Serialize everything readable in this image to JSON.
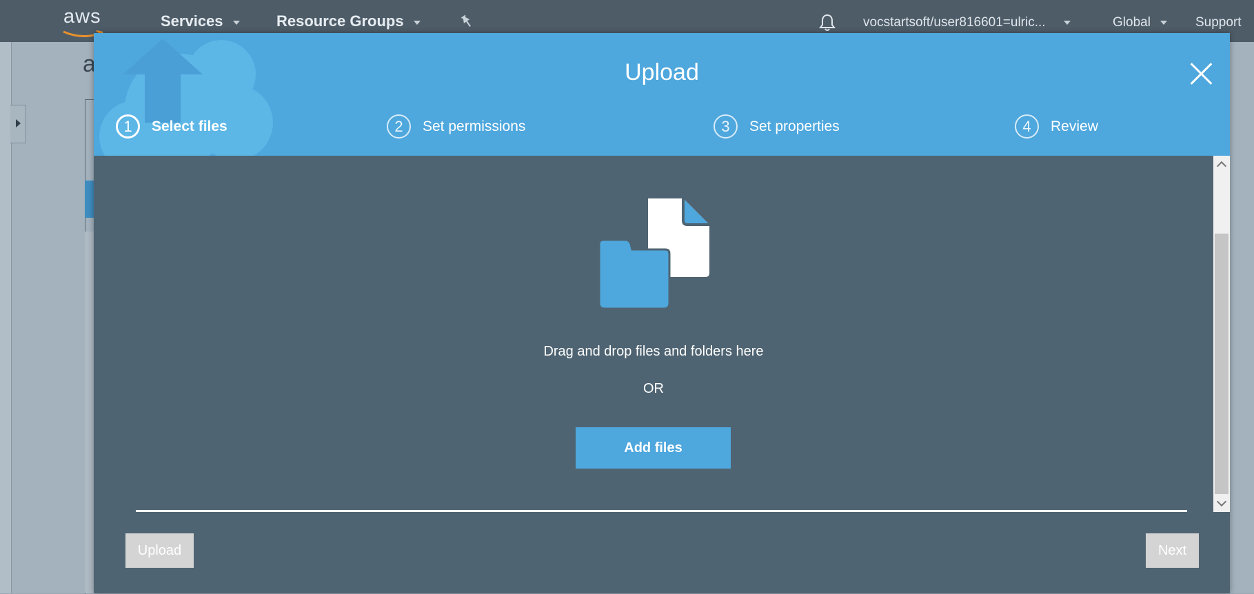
{
  "topnav": {
    "logo": "aws",
    "services": "Services",
    "resource_groups": "Resource Groups",
    "account": "vocstartsoft/user816601=ulric...",
    "region": "Global",
    "support": "Support"
  },
  "background": {
    "title_fragment": "a"
  },
  "modal": {
    "title": "Upload",
    "steps": [
      {
        "number": "1",
        "label": "Select files"
      },
      {
        "number": "2",
        "label": "Set permissions"
      },
      {
        "number": "3",
        "label": "Set properties"
      },
      {
        "number": "4",
        "label": "Review"
      }
    ],
    "drop_text": "Drag and drop files and folders here",
    "or_text": "OR",
    "add_files_label": "Add files",
    "upload_label": "Upload",
    "next_label": "Next"
  },
  "colors": {
    "header_blue": "#4ea7dd",
    "body_slate": "#4f6472",
    "nav_dark": "#4e5c68",
    "disabled_button": "#d4d4d4"
  }
}
